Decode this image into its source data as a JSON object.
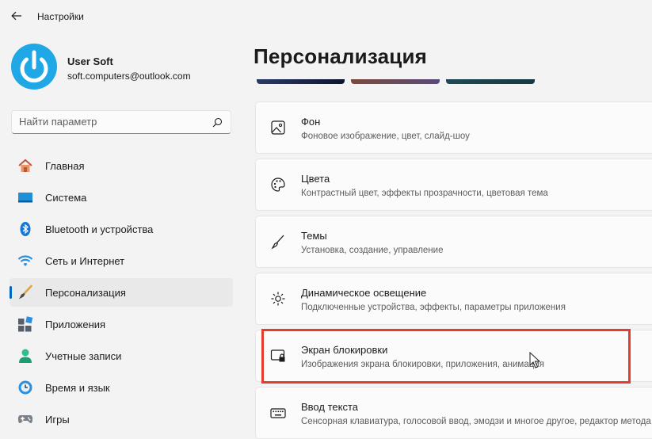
{
  "window": {
    "title": "Настройки"
  },
  "user": {
    "name": "User Soft",
    "email": "soft.computers@outlook.com"
  },
  "search": {
    "placeholder": "Найти параметр"
  },
  "nav": [
    {
      "label": "Главная",
      "icon": "home-icon"
    },
    {
      "label": "Система",
      "icon": "system-icon"
    },
    {
      "label": "Bluetooth и устройства",
      "icon": "bluetooth-icon"
    },
    {
      "label": "Сеть и Интернет",
      "icon": "wifi-icon"
    },
    {
      "label": "Персонализация",
      "icon": "brush-icon",
      "active": true
    },
    {
      "label": "Приложения",
      "icon": "apps-icon"
    },
    {
      "label": "Учетные записи",
      "icon": "person-icon"
    },
    {
      "label": "Время и язык",
      "icon": "clock-globe-icon"
    },
    {
      "label": "Игры",
      "icon": "gamepad-icon"
    }
  ],
  "page": {
    "title": "Персонализация"
  },
  "cards": [
    {
      "title": "Фон",
      "subtitle": "Фоновое изображение, цвет, слайд-шоу",
      "icon": "image-icon"
    },
    {
      "title": "Цвета",
      "subtitle": "Контрастный цвет, эффекты прозрачности, цветовая тема",
      "icon": "palette-icon"
    },
    {
      "title": "Темы",
      "subtitle": "Установка, создание, управление",
      "icon": "brush-icon"
    },
    {
      "title": "Динамическое освещение",
      "subtitle": "Подключенные устройства, эффекты, параметры приложения",
      "icon": "lighting-icon"
    },
    {
      "title": "Экран блокировки",
      "subtitle": "Изображения экрана блокировки, приложения, анимация",
      "icon": "lock-screen-icon",
      "highlighted": true
    },
    {
      "title": "Ввод текста",
      "subtitle": "Сенсорная клавиатура, голосовой ввод, эмодзи и многое другое, редактор метода ввода",
      "icon": "keyboard-icon"
    }
  ],
  "colors": {
    "accent": "#0067c0",
    "highlight": "#e53d2d",
    "avatar": "#20a7e6"
  }
}
